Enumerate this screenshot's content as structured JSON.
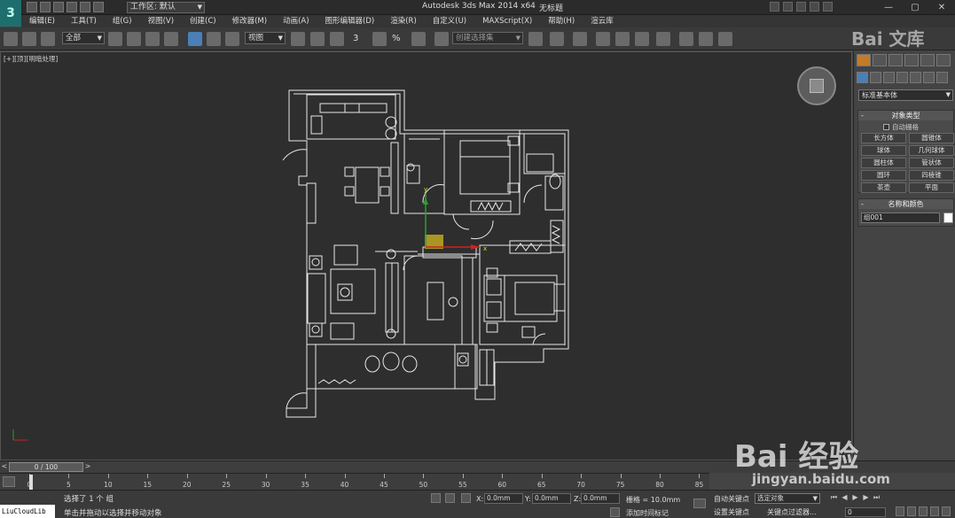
{
  "titlebar": {
    "app_logo": "3",
    "workspace_label": "工作区: 默认",
    "window_title": "Autodesk 3ds Max  2014 x64",
    "file_name": "无标题",
    "window_buttons": [
      "—",
      "▢",
      "✕"
    ]
  },
  "menu": {
    "items": [
      "编辑(E)",
      "工具(T)",
      "组(G)",
      "视图(V)",
      "创建(C)",
      "修改器(M)",
      "动画(A)",
      "图形编辑器(D)",
      "渲染(R)",
      "自定义(U)",
      "MAXScript(X)",
      "帮助(H)",
      "渲云库"
    ]
  },
  "toolbar": {
    "filter_value": "全部",
    "ref_coord_value": "视图",
    "named_selection_placeholder": "创建选择集",
    "snap_labels": [
      "3",
      "%",
      "n"
    ]
  },
  "viewport": {
    "label": "[+][顶][明暗处理]"
  },
  "command_panel": {
    "category_dropdown": "标准基本体",
    "object_type_title": "对象类型",
    "autogrid_label": "自动栅格",
    "object_buttons": [
      "长方体",
      "圆锥体",
      "球体",
      "几何球体",
      "圆柱体",
      "管状体",
      "圆环",
      "四棱锥",
      "茶壶",
      "平面"
    ],
    "name_color_title": "名称和颜色",
    "object_name": "组001",
    "object_color": "#ffffff"
  },
  "timeline": {
    "frame_display": "0 / 100",
    "ticks": [
      0,
      5,
      10,
      15,
      20,
      25,
      30,
      35,
      40,
      45,
      50,
      55,
      60,
      65,
      70,
      75,
      80,
      85
    ]
  },
  "status": {
    "maxscript_text": "LiuCloudLib i:",
    "selection_text": "选择了 1 个 组",
    "prompt_text": "单击并拖动以选择并移动对象",
    "x_label": "X:",
    "x_value": "0.0mm",
    "y_label": "Y:",
    "y_value": "0.0mm",
    "z_label": "Z:",
    "z_value": "0.0mm",
    "grid_text": "栅格 = 10.0mm",
    "add_time_tag": "添加时间标记",
    "auto_key": "自动关键点",
    "selected_dropdown": "选定对象",
    "set_key": "设置关键点",
    "key_filters": "关键点过滤器...",
    "current_frame": "0"
  },
  "watermark": {
    "top": "Bai 文库",
    "big": "Bai 经验",
    "url": "jingyan.baidu.com"
  }
}
